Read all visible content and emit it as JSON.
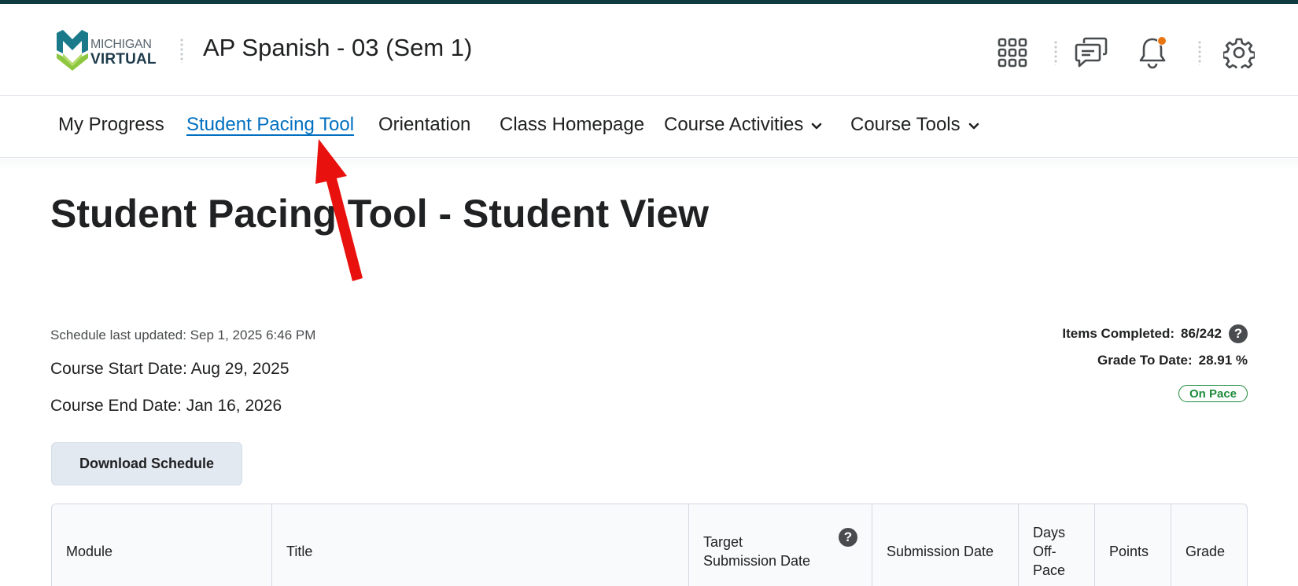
{
  "brand": {
    "logo_line1": "MICHIGAN",
    "logo_line2": "VIRTUAL",
    "colors": {
      "teal": "#1a7a8a",
      "green": "#8dc63f",
      "navy": "#1d3b4b",
      "accent_blue": "#006fbf",
      "on_pace_green": "#1c8a3a",
      "notification": "#e87511"
    }
  },
  "header": {
    "course_title": "AP Spanish - 03 (Sem 1)",
    "icons": [
      "apps-grid-icon",
      "messages-icon",
      "notifications-bell-icon",
      "settings-gear-icon"
    ]
  },
  "nav": {
    "items": [
      {
        "label": "My Progress",
        "active": false,
        "dropdown": false
      },
      {
        "label": "Student Pacing Tool",
        "active": true,
        "dropdown": false
      },
      {
        "label": "Orientation",
        "active": false,
        "dropdown": false
      },
      {
        "label": "Class Homepage",
        "active": false,
        "dropdown": false
      },
      {
        "label": "Course Activities",
        "active": false,
        "dropdown": true
      },
      {
        "label": "Course Tools",
        "active": false,
        "dropdown": true
      }
    ]
  },
  "page": {
    "title": "Student Pacing Tool - Student View",
    "schedule_updated": "Schedule last updated: Sep 1, 2025 6:46 PM",
    "course_start": "Course Start Date: Aug 29, 2025",
    "course_end": "Course End Date: Jan 16, 2026",
    "items_completed_label": "Items Completed:",
    "items_completed_value": "86/242",
    "grade_label": "Grade To Date:",
    "grade_value": "28.91 %",
    "status_badge": "On Pace",
    "download_button": "Download Schedule"
  },
  "table": {
    "headers": [
      "Module",
      "Title",
      "Target Submission Date",
      "Submission Date",
      "Days Off-Pace",
      "Points",
      "Grade"
    ]
  }
}
